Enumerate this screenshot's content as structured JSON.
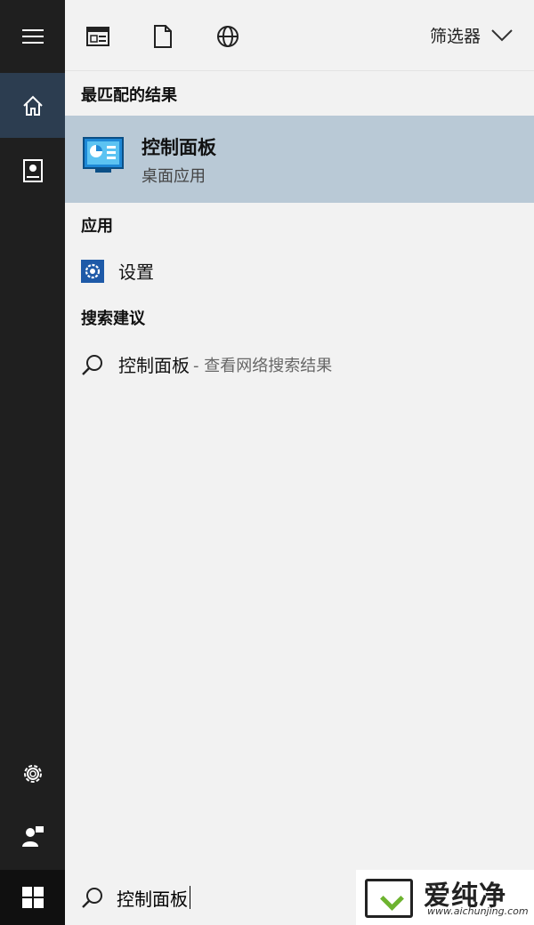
{
  "toolbar": {
    "icons": [
      "window-icon",
      "document-icon",
      "globe-icon"
    ],
    "filter_label": "筛选器"
  },
  "best_match": {
    "heading": "最匹配的结果",
    "title": "控制面板",
    "subtitle": "桌面应用"
  },
  "apps": {
    "heading": "应用",
    "items": [
      {
        "label": "设置",
        "icon": "settings-gear-icon"
      }
    ]
  },
  "suggestions": {
    "heading": "搜索建议",
    "items": [
      {
        "label": "控制面板",
        "suffix": "- 查看网络搜索结果"
      }
    ]
  },
  "search": {
    "query": "控制面板"
  },
  "watermark": {
    "text": "爱纯净",
    "url": "www.aichunjing.com"
  },
  "colors": {
    "rail": "#1f1f1f",
    "rail_active": "#2c3d50",
    "panel": "#f2f2f2",
    "selection": "#b9c9d6",
    "gear_accent": "#1e5aa8",
    "logo_green": "#6db32f"
  }
}
